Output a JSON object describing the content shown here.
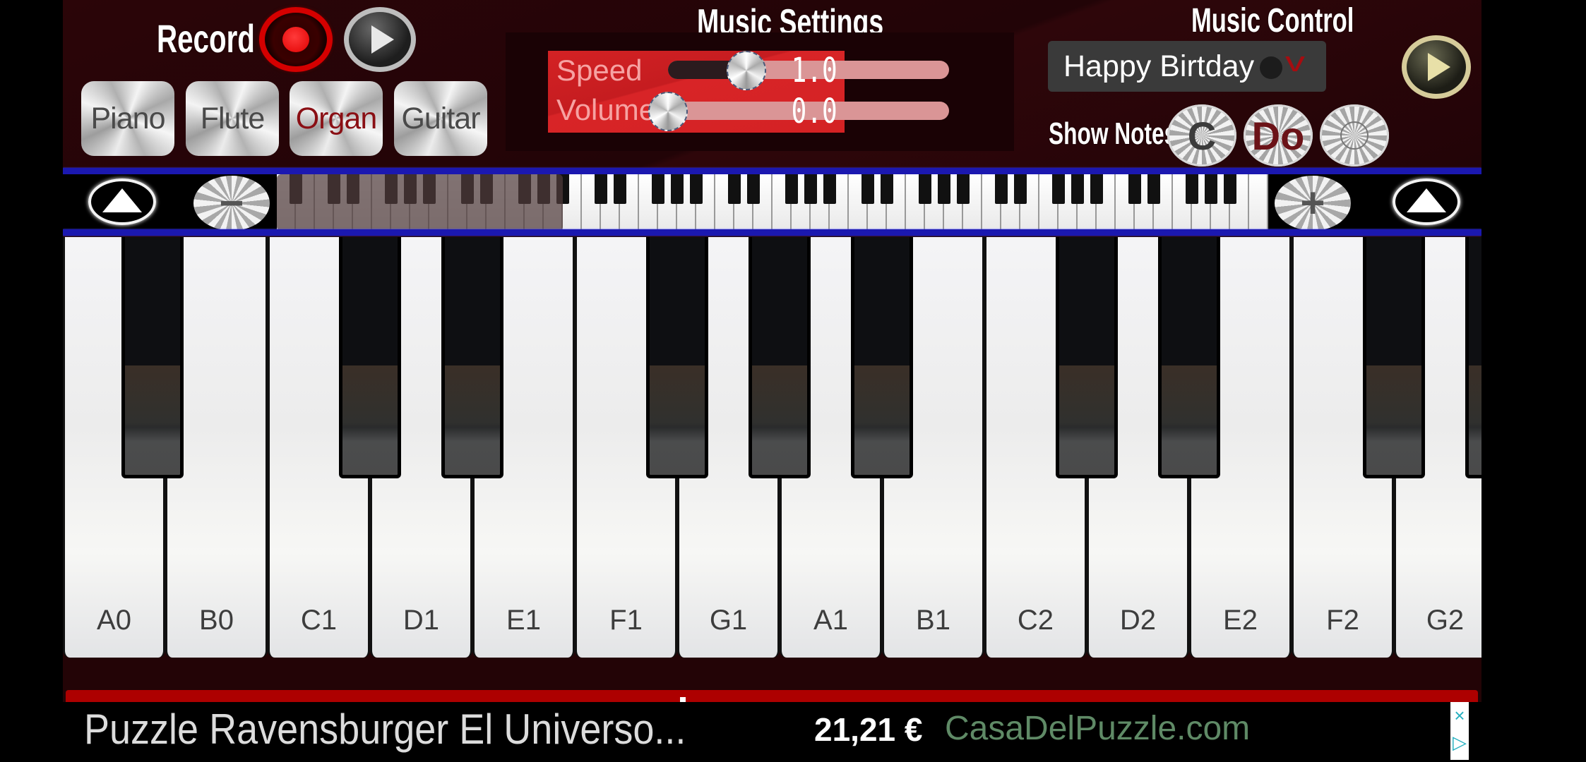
{
  "header": {
    "record": {
      "label": "Record"
    },
    "instruments": [
      {
        "label": "Piano",
        "active": false
      },
      {
        "label": "Flute",
        "active": false
      },
      {
        "label": "Organ",
        "active": true
      },
      {
        "label": "Guitar",
        "active": false
      }
    ],
    "music_settings": {
      "title": "Music Settings",
      "speed": {
        "label": "Speed",
        "value": "1.0",
        "fraction": 0.28
      },
      "volume": {
        "label": "Volume",
        "value": "0.0",
        "fraction": 0.0
      }
    },
    "music_control": {
      "title": "Music Control",
      "song": "Happy Birtday",
      "show_notes_label": "Show Notes",
      "note_buttons": [
        {
          "label": "C",
          "color": "#3b3b3b"
        },
        {
          "label": "Do",
          "color": "#6b1217"
        },
        {
          "label": "",
          "color": "#777777"
        }
      ]
    }
  },
  "mini_keyboard": {
    "white_key_count": 52,
    "selection_start_key": 0,
    "selection_key_count": 15
  },
  "keyboard": {
    "white_keys": [
      "A0",
      "B0",
      "C1",
      "D1",
      "E1",
      "F1",
      "G1",
      "A1",
      "B1",
      "C2",
      "D2",
      "E2",
      "F2",
      "G2"
    ],
    "black_after": [
      true,
      false,
      true,
      true,
      false,
      true,
      true,
      true,
      false,
      true,
      true,
      false,
      true,
      true
    ]
  },
  "ad": {
    "title": "Puzzle Ravensburger El Universo...",
    "price": "21,21 €",
    "link": "CasaDelPuzzle.com",
    "close_icon": "×",
    "adchoices_icon": "▷"
  },
  "colors": {
    "background": "#230406",
    "accent_red": "#d42224",
    "blue_line": "#1b18b0",
    "active_instrument": "#8a0f14"
  }
}
